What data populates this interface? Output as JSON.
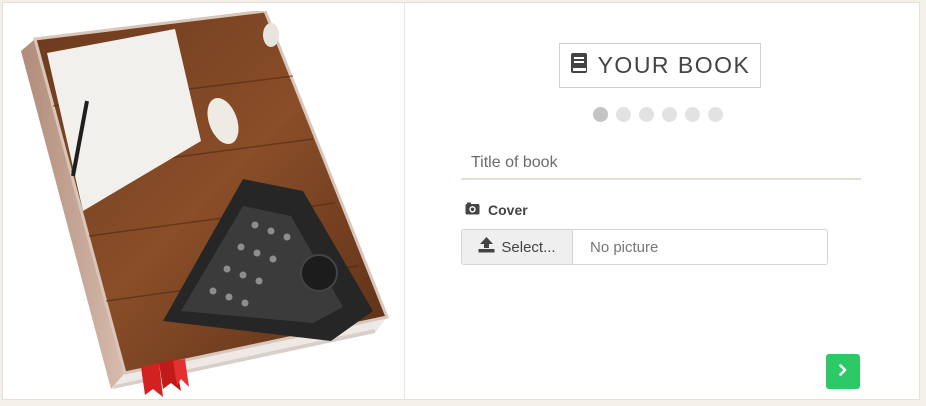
{
  "header": {
    "title": "YOUR BOOK",
    "title_icon": "book-icon"
  },
  "steps": {
    "total": 6,
    "active_index": 0
  },
  "form": {
    "title_placeholder": "Title of book",
    "title_value": "",
    "cover_label": "Cover",
    "cover_icon": "camera-icon",
    "select_label": "Select...",
    "select_icon": "upload-icon",
    "file_status": "No picture"
  },
  "navigation": {
    "next_icon": "chevron-right-icon"
  },
  "colors": {
    "accent_green": "#2ec967",
    "underline": "#e9ddcc",
    "dot_active": "#c4c4c4",
    "dot_inactive": "#e2e2e2"
  }
}
